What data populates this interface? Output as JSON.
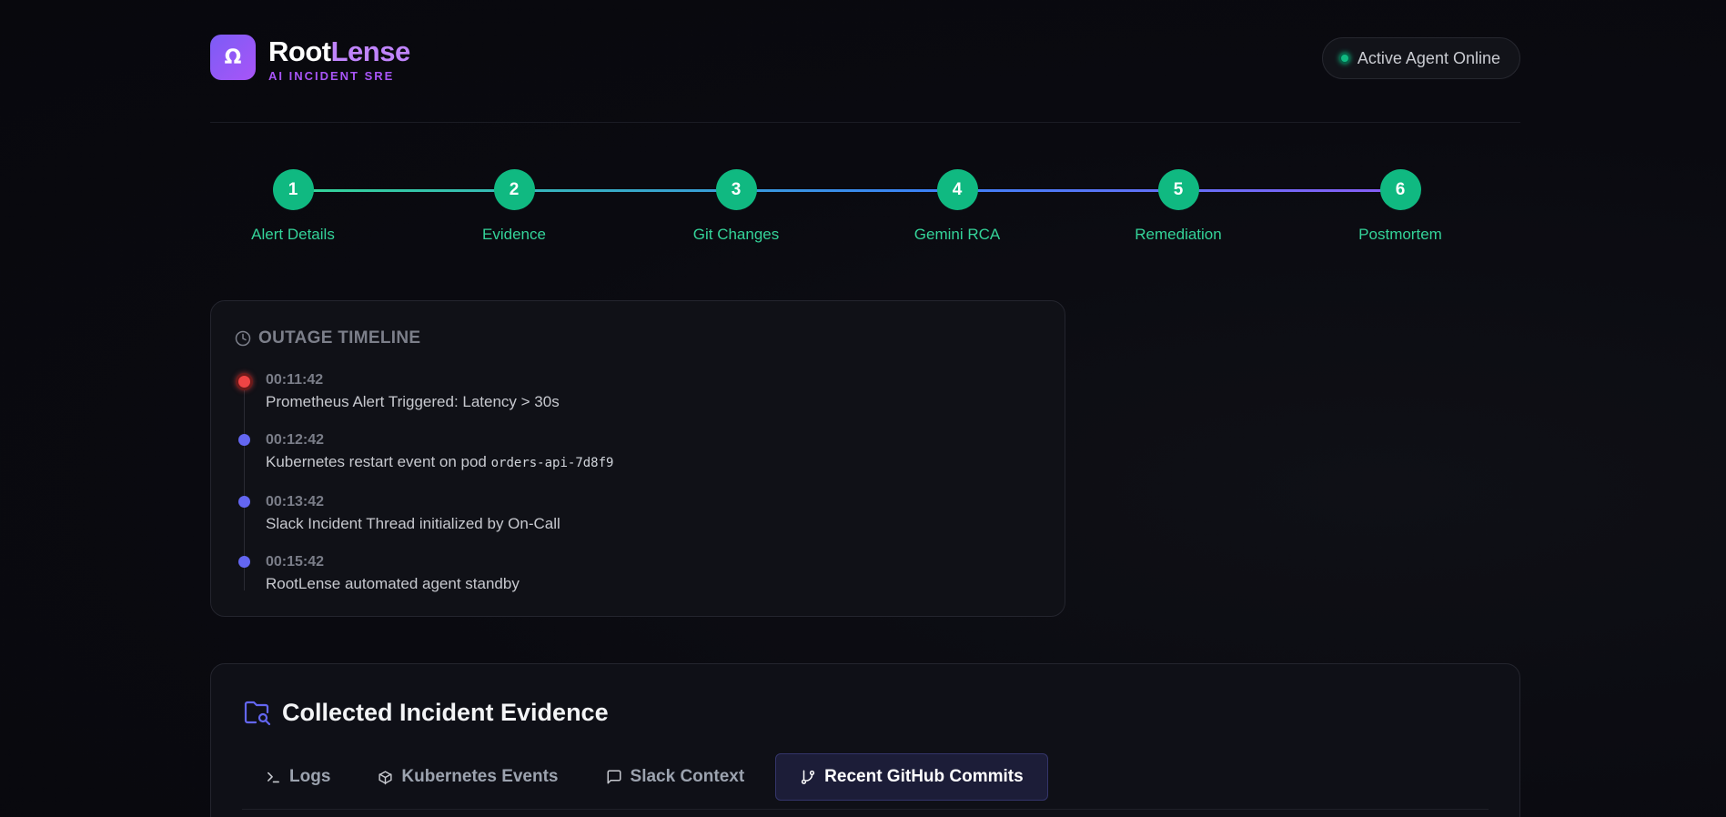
{
  "brand": {
    "logo_glyph": "Ω",
    "name_part1": "Root",
    "name_part2": "Lense",
    "subtitle": "AI INCIDENT SRE"
  },
  "status": {
    "label": "Active Agent Online",
    "color": "#10b981"
  },
  "stepper": {
    "steps": [
      {
        "number": "1",
        "label": "Alert Details"
      },
      {
        "number": "2",
        "label": "Evidence"
      },
      {
        "number": "3",
        "label": "Git Changes"
      },
      {
        "number": "4",
        "label": "Gemini RCA"
      },
      {
        "number": "5",
        "label": "Remediation"
      },
      {
        "number": "6",
        "label": "Postmortem"
      }
    ]
  },
  "timeline": {
    "title": "OUTAGE TIMELINE",
    "events": [
      {
        "time": "00:11:42",
        "text": "Prometheus Alert Triggered: Latency > 30s",
        "severity": "alert"
      },
      {
        "time": "00:12:42",
        "text": "Kubernetes restart event on pod ",
        "code": "orders-api-7d8f9",
        "severity": "info"
      },
      {
        "time": "00:13:42",
        "text": "Slack Incident Thread initialized by On-Call",
        "severity": "info"
      },
      {
        "time": "00:15:42",
        "text": "RootLense automated agent standby",
        "severity": "info"
      }
    ]
  },
  "evidence": {
    "title": "Collected Incident Evidence",
    "tabs": [
      {
        "label": "Logs",
        "icon": "terminal-icon",
        "active": false
      },
      {
        "label": "Kubernetes Events",
        "icon": "cube-icon",
        "active": false
      },
      {
        "label": "Slack Context",
        "icon": "message-icon",
        "active": false
      },
      {
        "label": "Recent GitHub Commits",
        "icon": "git-branch-icon",
        "active": true
      }
    ]
  },
  "colors": {
    "accent": "#a855f7",
    "success": "#10b981",
    "alert": "#ef4444",
    "info": "#6366f1"
  }
}
